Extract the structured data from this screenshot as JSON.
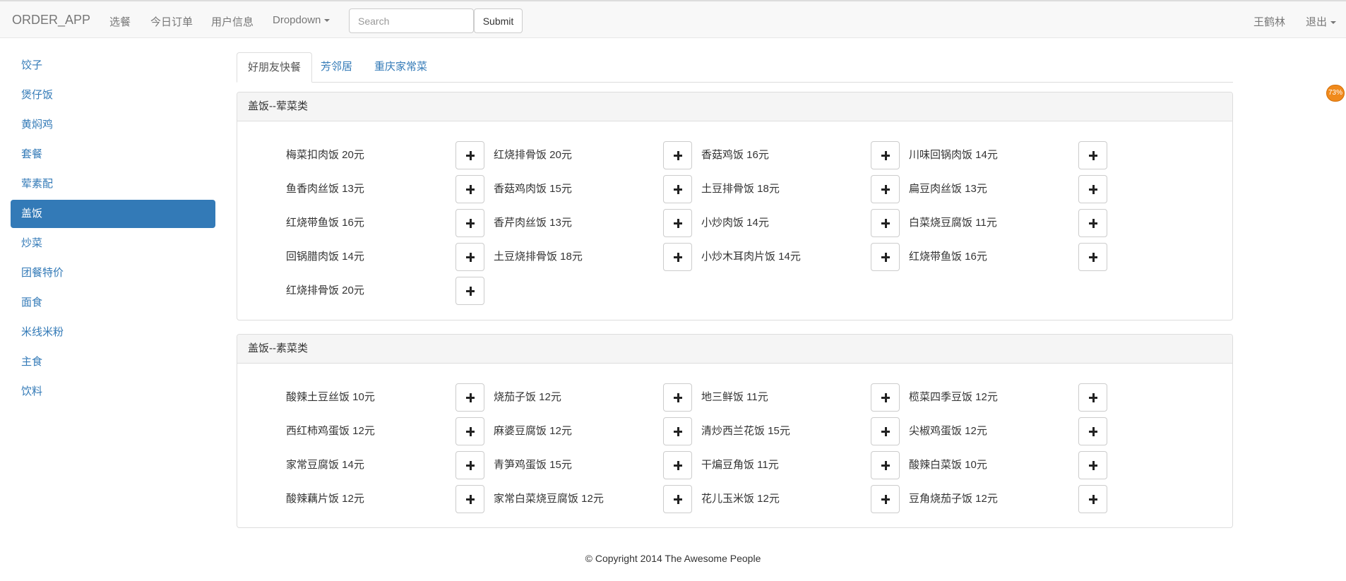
{
  "navbar": {
    "brand": "ORDER_APP",
    "links": [
      "选餐",
      "今日订单",
      "用户信息"
    ],
    "dropdown": "Dropdown",
    "search_placeholder": "Search",
    "submit_label": "Submit",
    "user": "王鹤林",
    "logout": "退出"
  },
  "sidebar": {
    "items": [
      "饺子",
      "煲仔饭",
      "黄焖鸡",
      "套餐",
      "荤素配",
      "盖饭",
      "炒菜",
      "团餐特价",
      "面食",
      "米线米粉",
      "主食",
      "饮料"
    ],
    "active_index": 5
  },
  "tabs": [
    "好朋友快餐",
    "芳邻居",
    "重庆家常菜"
  ],
  "active_tab": 0,
  "panels": [
    {
      "title": "盖饭--荤菜类",
      "dishes": [
        "梅菜扣肉饭 20元",
        "红烧排骨饭 20元",
        "香菇鸡饭 16元",
        "川味回锅肉饭 14元",
        "鱼香肉丝饭 13元",
        "香菇鸡肉饭 15元",
        "土豆排骨饭 18元",
        "扁豆肉丝饭 13元",
        "红烧带鱼饭 16元",
        "香芹肉丝饭 13元",
        "小炒肉饭 14元",
        "白菜烧豆腐饭 11元",
        "回锅腊肉饭 14元",
        "土豆烧排骨饭 18元",
        "小炒木耳肉片饭 14元",
        "红烧带鱼饭 16元",
        "红烧排骨饭 20元"
      ]
    },
    {
      "title": "盖饭--素菜类",
      "dishes": [
        "酸辣土豆丝饭 10元",
        "烧茄子饭 12元",
        "地三鲜饭 11元",
        "榄菜四季豆饭 12元",
        "西红柿鸡蛋饭 12元",
        "麻婆豆腐饭 12元",
        "清炒西兰花饭 15元",
        "尖椒鸡蛋饭 12元",
        "家常豆腐饭 14元",
        "青笋鸡蛋饭 15元",
        "干煸豆角饭 11元",
        "酸辣白菜饭 10元",
        "酸辣藕片饭 12元",
        "家常白菜烧豆腐饭 12元",
        "花儿玉米饭 12元",
        "豆角烧茄子饭 12元"
      ]
    }
  ],
  "footer": "© Copyright 2014 The Awesome People",
  "floating_badge": "73%",
  "colors": {
    "accent": "#337ab7",
    "navbar_bg": "#f8f8f8",
    "badge": "#f08a1c"
  }
}
